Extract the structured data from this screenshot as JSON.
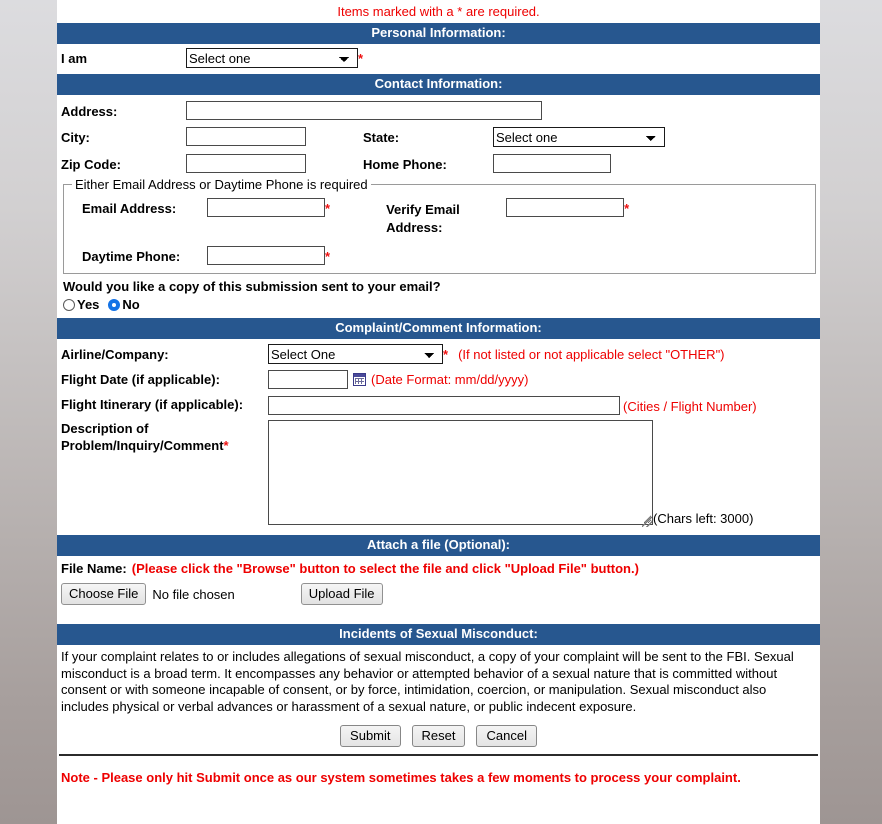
{
  "required_note": "Items marked with a * are required.",
  "sections": {
    "personal": "Personal Information:",
    "contact": "Contact Information:",
    "complaint": "Complaint/Comment Information:",
    "attach": "Attach a file (Optional):",
    "misconduct": "Incidents of Sexual Misconduct:"
  },
  "personal": {
    "i_am_label": "I am",
    "i_am_value": "Select one",
    "required_star": "*"
  },
  "contact": {
    "address_label": "Address:",
    "address_value": "",
    "city_label": "City:",
    "city_value": "",
    "state_label": "State:",
    "state_value": "Select one",
    "zip_label": "Zip Code:",
    "zip_value": "",
    "home_phone_label": "Home Phone:",
    "home_phone_value": "",
    "fieldset_legend": "Either Email Address or Daytime Phone is required",
    "email_label": "Email Address:",
    "email_value": "",
    "verify_email_label": "Verify Email Address:",
    "verify_email_value": "",
    "daytime_phone_label": "Daytime Phone:",
    "daytime_phone_value": "",
    "copy_question": "Would you like a copy of this submission sent to your email?",
    "yes_label": "Yes",
    "no_label": "No",
    "copy_selected": "No"
  },
  "complaint": {
    "airline_label": "Airline/Company:",
    "airline_value": "Select One",
    "airline_hint": "(If not listed or not applicable select \"OTHER\")",
    "flight_date_label": "Flight Date (if applicable):",
    "flight_date_value": "",
    "date_format_hint": "(Date Format: mm/dd/yyyy)",
    "itinerary_label": "Flight Itinerary (if applicable):",
    "itinerary_value": "",
    "itinerary_hint": "(Cities / Flight Number)",
    "description_label": "Description of Problem/Inquiry/Comment",
    "description_value": "",
    "chars_left": "(Chars left: 3000)"
  },
  "attach": {
    "file_name_label": "File Name:",
    "file_instruction": "(Please click the \"Browse\" button to select the file and click \"Upload File\" button.)",
    "choose_file_label": "Choose File",
    "no_file_text": "No file chosen",
    "upload_label": "Upload File"
  },
  "misconduct": {
    "body": "If your complaint relates to or includes allegations of sexual misconduct, a copy of your complaint will be sent to the FBI. Sexual misconduct is a broad term. It encompasses any behavior or attempted behavior of a sexual nature that is committed without consent or with someone incapable of consent, or by force, intimidation, coercion, or manipulation. Sexual misconduct also includes physical or verbal advances or harassment of a sexual nature, or public indecent exposure."
  },
  "actions": {
    "submit_label": "Submit",
    "reset_label": "Reset",
    "cancel_label": "Cancel"
  },
  "footer": {
    "note": "Note - Please only hit Submit once as our system sometimes takes a few moments to process your complaint."
  },
  "colors": {
    "header_blue": "#27578f",
    "required_red": "#ee0000",
    "radio_selected": "#1473e6"
  }
}
